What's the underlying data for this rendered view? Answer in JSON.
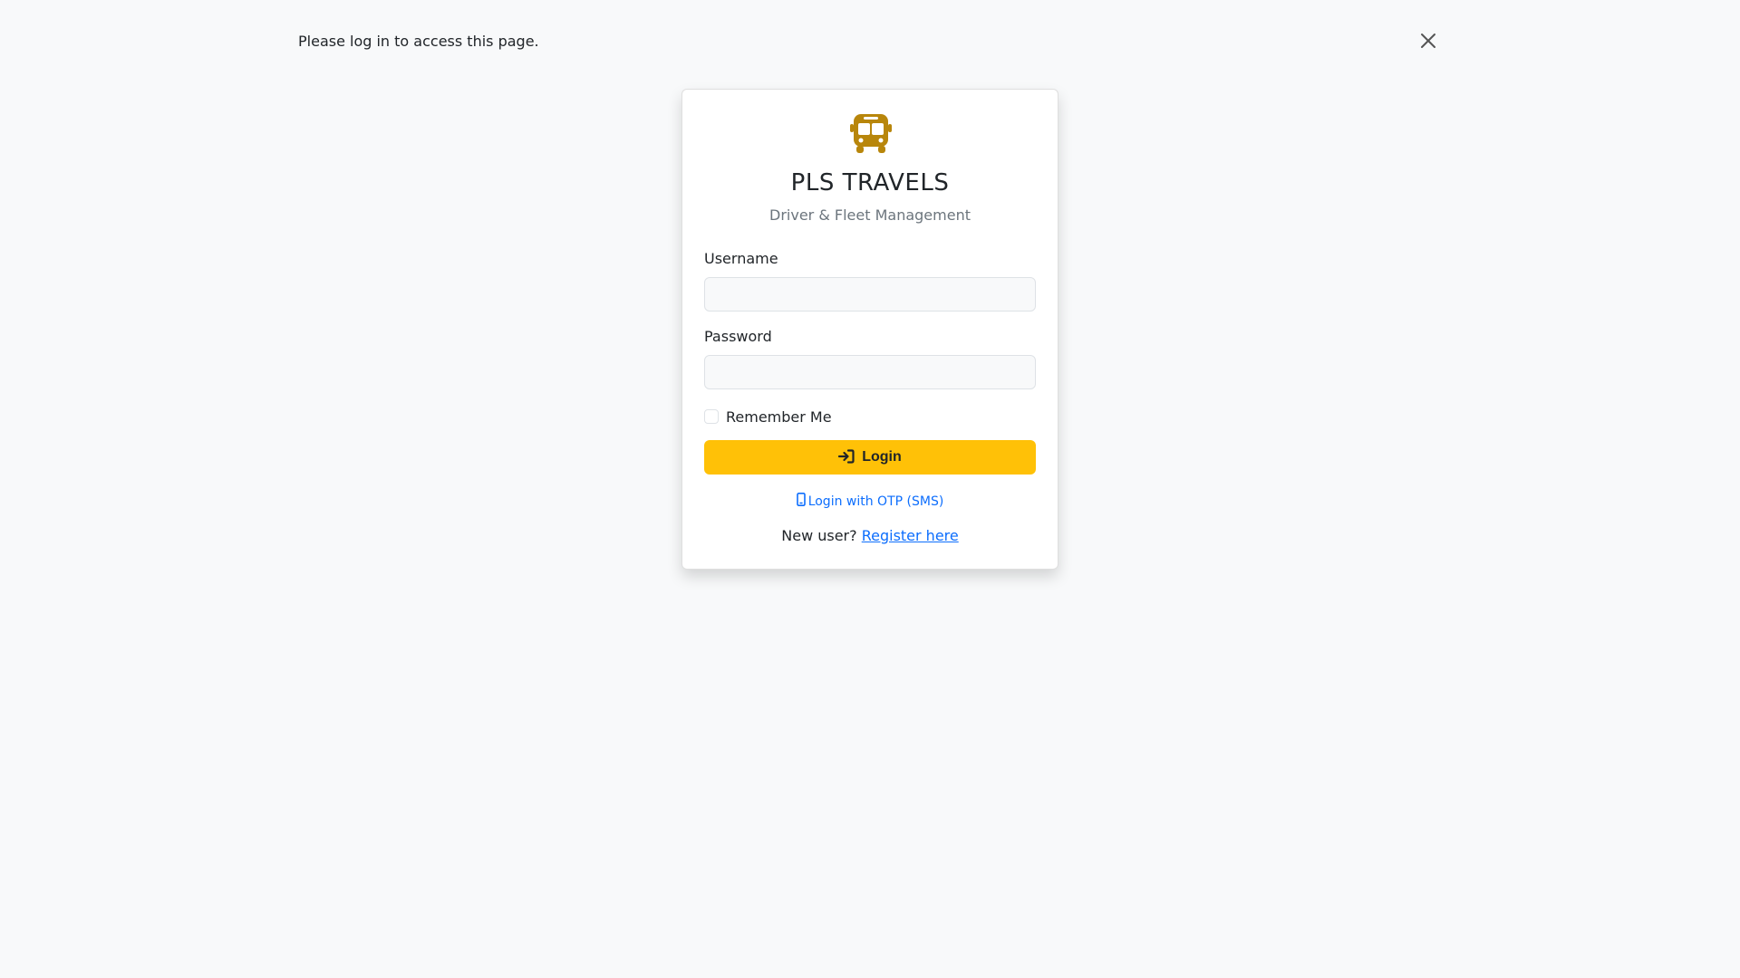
{
  "alert": {
    "message": "Please log in to access this page."
  },
  "brand": {
    "logo_icon": "bus-icon",
    "title": "PLS TRAVELS",
    "subtitle": "Driver & Fleet Management"
  },
  "form": {
    "username_label": "Username",
    "username_value": "",
    "password_label": "Password",
    "password_value": "",
    "remember_label": "Remember Me",
    "remember_checked": false,
    "login_label": "Login",
    "login_icon": "sign-in-icon"
  },
  "otp": {
    "icon": "mobile-phone-icon",
    "label": "Login with OTP (SMS)"
  },
  "register": {
    "prompt": "New user?",
    "link_label": "Register here"
  },
  "colors": {
    "accent": "#ffc107",
    "logo": "#b8860b",
    "link": "#0d6efd",
    "background": "#f8f9fa"
  }
}
